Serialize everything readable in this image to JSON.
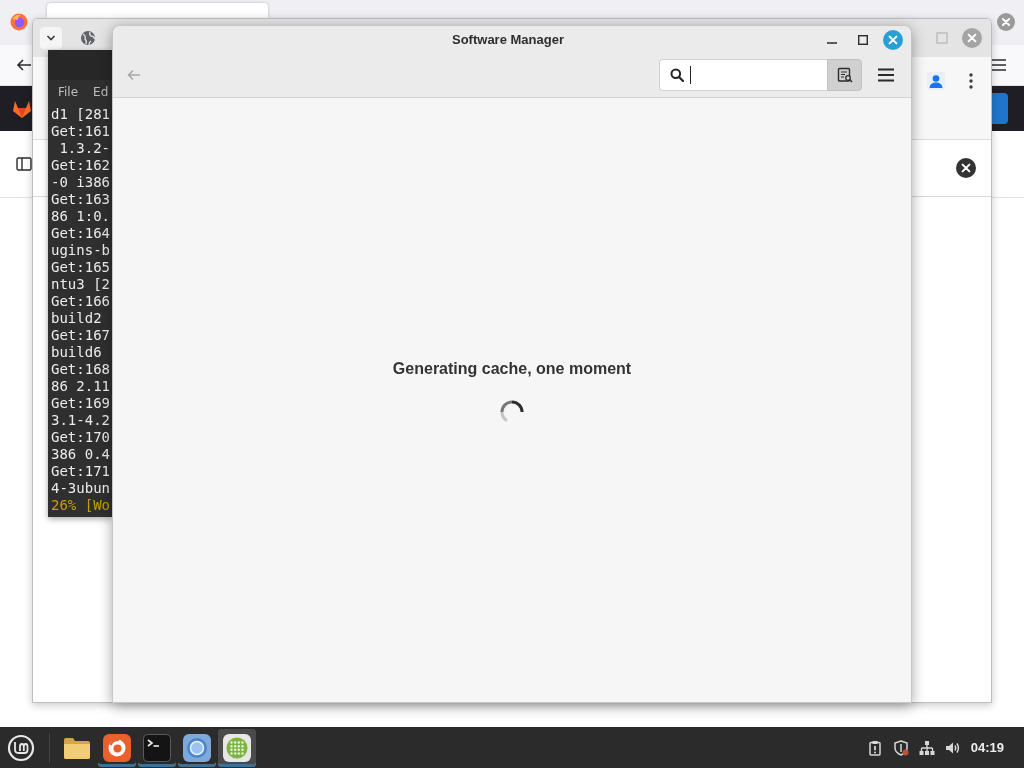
{
  "terminal": {
    "menu": [
      "File",
      "Ed"
    ],
    "lines": [
      {
        "kind": "output",
        "text": "d1 [281"
      },
      {
        "kind": "output",
        "text": "Get:161"
      },
      {
        "kind": "output",
        "text": " 1.3.2-"
      },
      {
        "kind": "output",
        "text": "Get:162"
      },
      {
        "kind": "output",
        "text": "-0 i386"
      },
      {
        "kind": "output",
        "text": "Get:163"
      },
      {
        "kind": "output",
        "text": "86 1:0."
      },
      {
        "kind": "output",
        "text": "Get:164"
      },
      {
        "kind": "output",
        "text": "ugins-b"
      },
      {
        "kind": "output",
        "text": "Get:165"
      },
      {
        "kind": "output",
        "text": "ntu3 [2"
      },
      {
        "kind": "output",
        "text": "Get:166"
      },
      {
        "kind": "output",
        "text": "build2"
      },
      {
        "kind": "output",
        "text": "Get:167"
      },
      {
        "kind": "output",
        "text": "build6"
      },
      {
        "kind": "output",
        "text": "Get:168"
      },
      {
        "kind": "output",
        "text": "86 2.11"
      },
      {
        "kind": "output",
        "text": "Get:169"
      },
      {
        "kind": "output",
        "text": "3.1-4.2"
      },
      {
        "kind": "output",
        "text": "Get:170"
      },
      {
        "kind": "output",
        "text": "386 0.4"
      },
      {
        "kind": "output",
        "text": "Get:171"
      },
      {
        "kind": "output",
        "text": "4-3ubun"
      },
      {
        "kind": "progress",
        "text": "26% [Wo"
      }
    ]
  },
  "software_manager": {
    "title": "Software Manager",
    "back_button": {
      "disabled": true
    },
    "search": {
      "focused": true
    },
    "search_toggle": {
      "pressed": true
    },
    "message": "Generating cache, one moment",
    "busy": true
  },
  "taskbar": {
    "launchers": [
      {
        "kind": "files",
        "active": false,
        "running": false
      },
      {
        "kind": "firefox",
        "active": false,
        "running": true
      },
      {
        "kind": "terminal",
        "active": false,
        "running": true
      },
      {
        "kind": "chromium",
        "active": false,
        "running": true
      },
      {
        "kind": "software",
        "active": true,
        "running": true
      }
    ],
    "tray": [
      {
        "kind": "updates"
      },
      {
        "kind": "shield"
      },
      {
        "kind": "network"
      },
      {
        "kind": "volume"
      }
    ],
    "clock": "04:19"
  }
}
